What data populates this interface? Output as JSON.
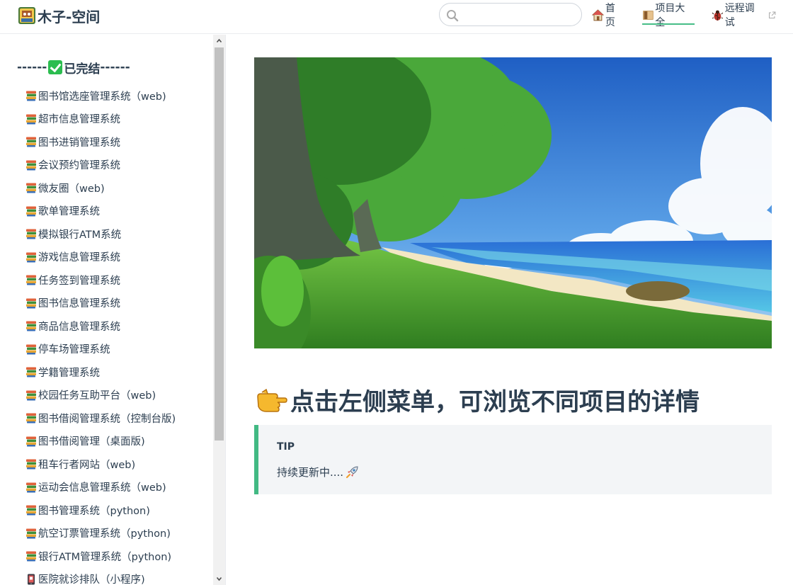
{
  "site": {
    "title": "木子-空间"
  },
  "search": {
    "value": "",
    "placeholder": ""
  },
  "nav": {
    "items": [
      {
        "label": "首页",
        "icon": "house-icon"
      },
      {
        "label": "项目大全",
        "icon": "books-icon",
        "active": true
      },
      {
        "label": "远程调试",
        "icon": "bug-icon",
        "external": true
      }
    ]
  },
  "sidebar": {
    "group": {
      "prefix": "------",
      "label": "已完结",
      "suffix": "------",
      "icon": "check-mark-icon"
    },
    "items": [
      {
        "label": "图书馆选座管理系统（web)",
        "icon": "books-icon"
      },
      {
        "label": "超市信息管理系统",
        "icon": "books-icon"
      },
      {
        "label": "图书进销管理系统",
        "icon": "books-icon"
      },
      {
        "label": "会议预约管理系统",
        "icon": "books-icon"
      },
      {
        "label": "微友圈（web)",
        "icon": "books-icon"
      },
      {
        "label": "歌单管理系统",
        "icon": "books-icon"
      },
      {
        "label": "模拟银行ATM系统",
        "icon": "books-icon"
      },
      {
        "label": "游戏信息管理系统",
        "icon": "books-icon"
      },
      {
        "label": "任务签到管理系统",
        "icon": "books-icon"
      },
      {
        "label": "图书信息管理系统",
        "icon": "books-icon"
      },
      {
        "label": "商品信息管理系统",
        "icon": "books-icon"
      },
      {
        "label": "停车场管理系统",
        "icon": "books-icon"
      },
      {
        "label": "学籍管理系统",
        "icon": "books-icon"
      },
      {
        "label": "校园任务互助平台（web)",
        "icon": "books-icon"
      },
      {
        "label": "图书借阅管理系统（控制台版)",
        "icon": "books-icon"
      },
      {
        "label": "图书借阅管理（桌面版)",
        "icon": "books-icon"
      },
      {
        "label": "租车行者网站（web)",
        "icon": "books-icon"
      },
      {
        "label": "运动会信息管理系统（web)",
        "icon": "books-icon"
      },
      {
        "label": "图书管理系统（python)",
        "icon": "books-icon"
      },
      {
        "label": "航空订票管理系统（python)",
        "icon": "books-icon"
      },
      {
        "label": "银行ATM管理系统（python)",
        "icon": "books-icon"
      },
      {
        "label": "医院就诊排队（小程序)",
        "icon": "mobile-phone-icon"
      }
    ]
  },
  "main": {
    "headline": "点击左侧菜单，可浏览不同项目的详情",
    "tip": {
      "title": "TIP",
      "text": "持续更新中...."
    }
  },
  "colors": {
    "accent": "#42b983",
    "text": "#2c3e50",
    "tip_bg": "#f3f5f7"
  }
}
